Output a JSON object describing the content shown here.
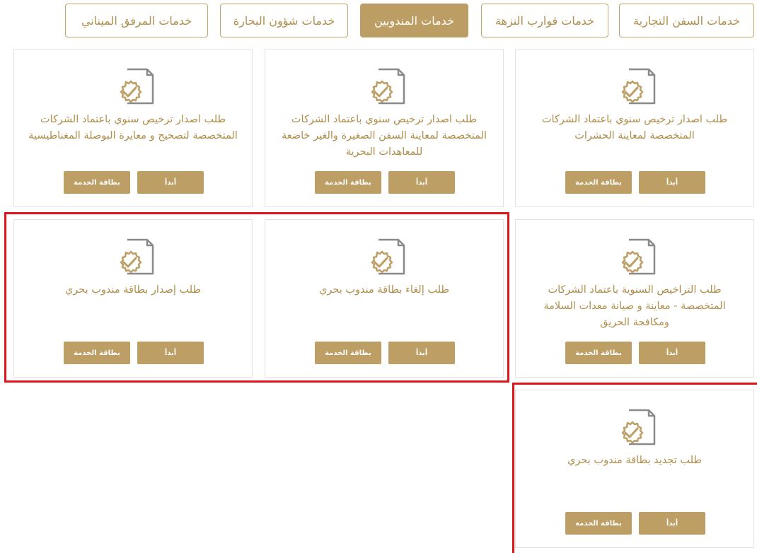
{
  "tabs": [
    {
      "label": "خدمات السفن التجارية",
      "active": false
    },
    {
      "label": "خدمات قوارب النزهة",
      "active": false
    },
    {
      "label": "خدمات المندوبين",
      "active": true
    },
    {
      "label": "خدمات شؤون البحارة",
      "active": false
    },
    {
      "label": "خدمات المرفق الميناني",
      "active": false
    }
  ],
  "buttons": {
    "start": "أبدأ",
    "card": "بطاقة الخدمة"
  },
  "services": [
    {
      "title": "طلب اصدار ترخيص سنوي باعتماد الشركات المتخصصة لمعاينة الحشرات"
    },
    {
      "title": "طلب اصدار ترخيص سنوي باعتماد الشركات المتخصصة لمعاينة السفن الصغيرة والغير خاضعة للمعاهدات البحرية"
    },
    {
      "title": "طلب اصدار ترخيص سنوي باعتماد الشركات المتخصصة لتصحيح و معايرة البوصلة المغناطيسية"
    },
    {
      "title": "طلب التراخيص السنوية باعتماد الشركات المتخصصة - معاينة و صيانة معدات السلامة ومكافحة الحريق"
    },
    {
      "title": "طلب إلغاء بطاقة مندوب بحري"
    },
    {
      "title": "طلب إصدار بطاقة مندوب بحري"
    },
    {
      "title": "طلب تجديد بطاقة مندوب بحري"
    }
  ],
  "colors": {
    "accent": "#bd9e64",
    "icon_gray": "#8a8a8a",
    "highlight": "#e0141b"
  },
  "icon": "document-gear-check-icon"
}
